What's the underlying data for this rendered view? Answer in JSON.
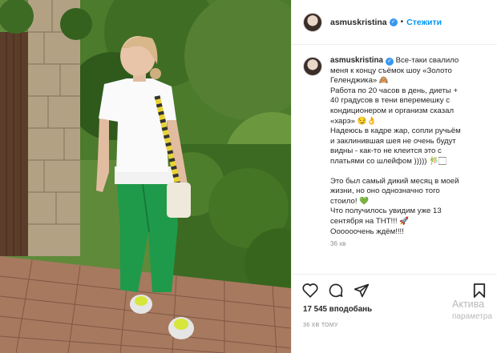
{
  "post": {
    "username": "asmuskristina",
    "verified_icon": "verified-badge-icon",
    "separator": "•",
    "follow_label": "Стежити",
    "caption_lines": [
      "Все-таки свалило",
      "меня к концу съёмок шоу «Золото",
      "Геленджика» 🙈",
      "Работа по 20 часов в день, диеты +",
      "40 градусов в тени вперемешку с",
      "кондиционером и организм сказал",
      "«харэ» 😏👌",
      "Надеюсь в кадре жар, сопли ручьём",
      "и заклинившая шея не очень будут",
      "видны - как-то не клеится это с",
      "платьями со шлейфом ))))) 🎋🏻",
      "",
      "Это был самый дикий месяц в моей",
      "жизни, но оно однозначно того",
      "стоило! 💚",
      "Что получилось увидим уже 13",
      "сентября на ТНТ!!! 🚀",
      "Оооооочень ждём!!!!"
    ],
    "comment_time": "36 хв",
    "likes": "17 545 вподобань",
    "time_ago": "36 ХВ ТОМУ"
  },
  "actions": {
    "like_icon": "heart-icon",
    "comment_icon": "comment-icon",
    "share_icon": "share-icon",
    "save_icon": "bookmark-icon"
  },
  "watermark": {
    "line1": "Актива",
    "line2": "параметра"
  },
  "colors": {
    "accent": "#0095f6",
    "verified": "#3897f0",
    "secondary_text": "#8e8e8e",
    "trousers": "#1f9a4a"
  }
}
